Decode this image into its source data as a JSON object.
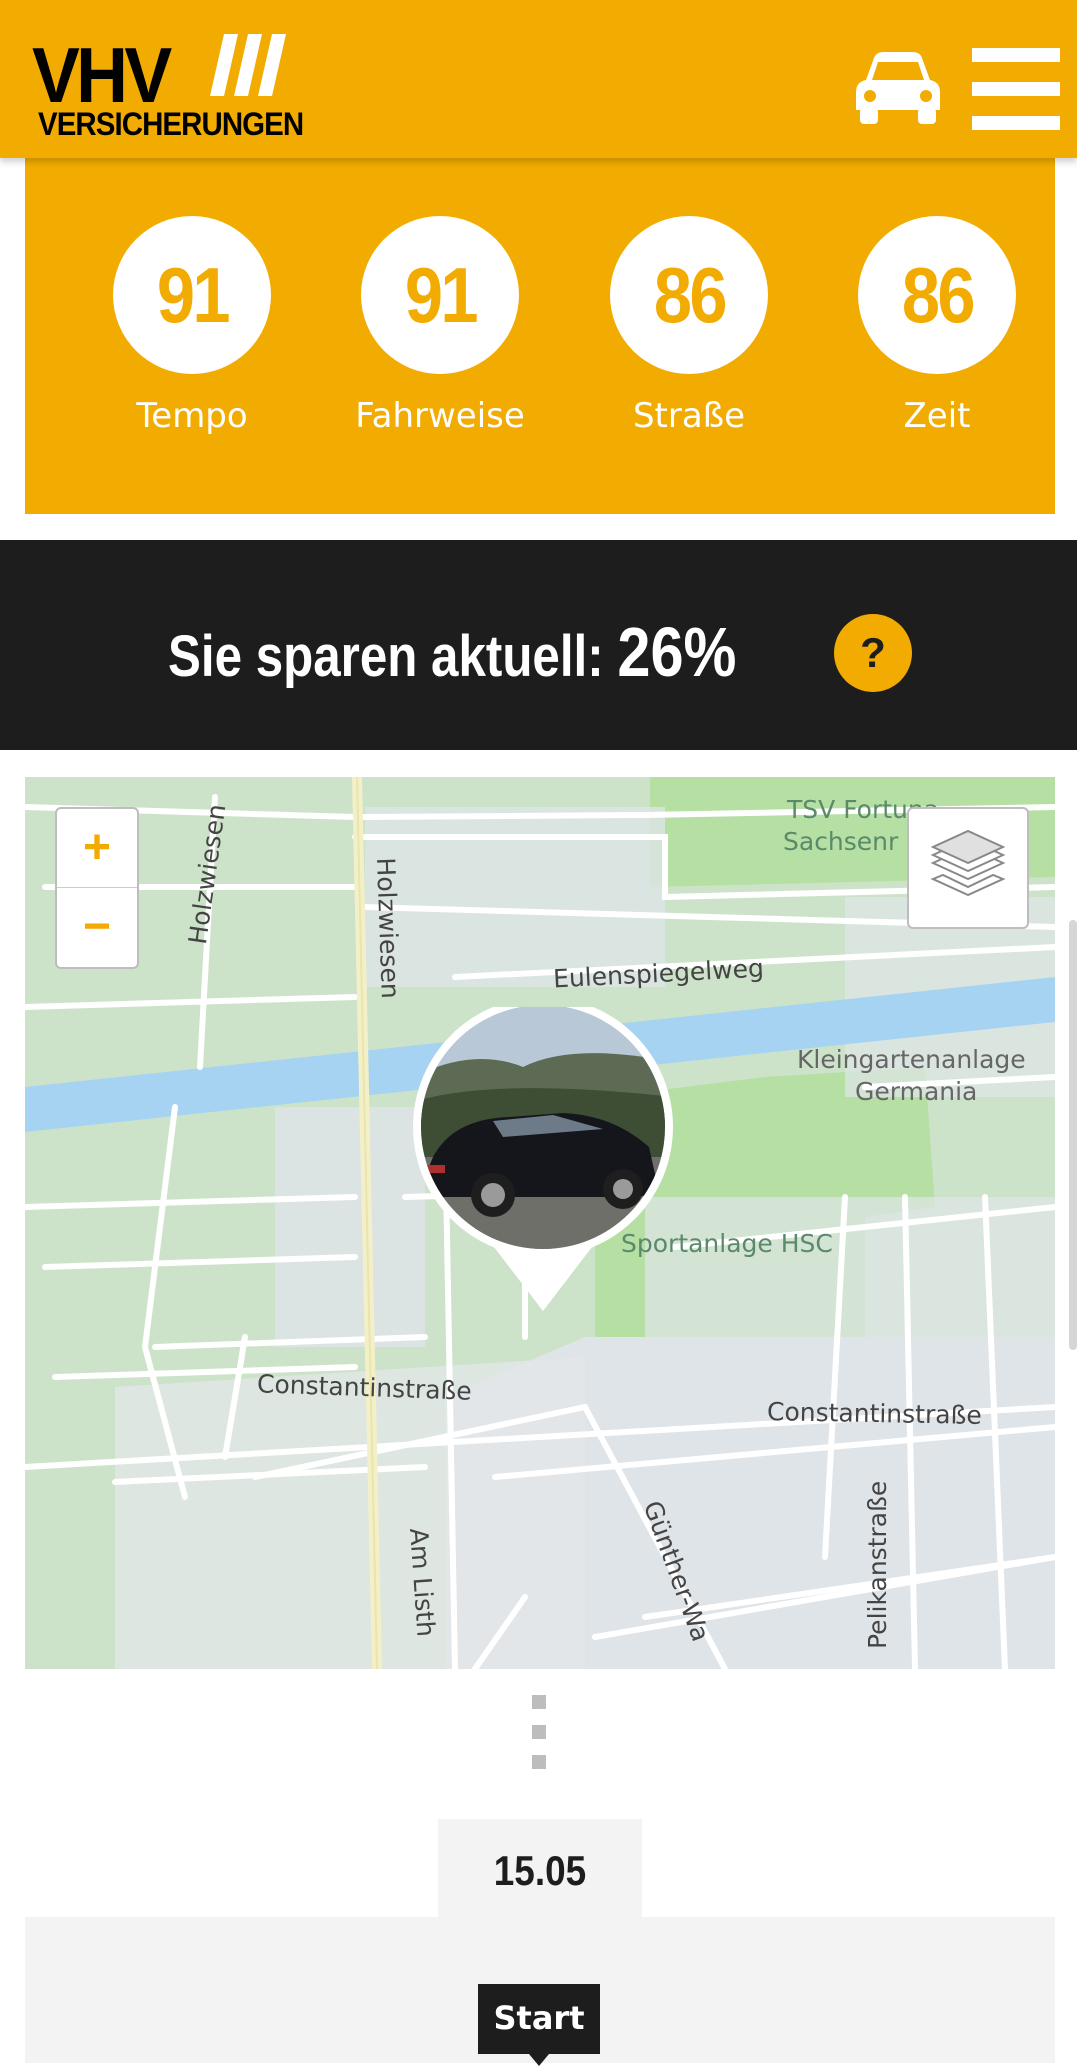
{
  "header": {
    "logo_main": "VHV",
    "logo_sub": "VERSICHERUNGEN",
    "car_icon": "car-icon",
    "menu_icon": "hamburger-menu-icon",
    "brand_color": "#f2ab00"
  },
  "scores": [
    {
      "value": "91",
      "label": "Tempo"
    },
    {
      "value": "91",
      "label": "Fahrweise"
    },
    {
      "value": "86",
      "label": "Straße"
    },
    {
      "value": "86",
      "label": "Zeit"
    }
  ],
  "savings": {
    "text": "Sie sparen aktuell:",
    "percent": "26%",
    "help_label": "?"
  },
  "map": {
    "zoom_in": "+",
    "zoom_out": "−",
    "layers_icon": "layers-icon",
    "labels": {
      "holzwiesen_a": "Holzwiesen",
      "holzwiesen_b": "Holzwiesen",
      "tsv": "TSV Fortuna",
      "tsv2": "Sachsenr",
      "eulenspiegelweg": "Eulenspiegelweg",
      "kleingarten1": "Kleingartenanlage",
      "kleingarten2": "Germania",
      "sportanlage": "Sportanlage HSC",
      "constantin_a": "Constantinstraße",
      "constantin_b": "Constantinstraße",
      "am_listh": "Am Listh",
      "guenther": "Günther-Wa",
      "pelikan": "Pelikanstraße"
    }
  },
  "timeline": {
    "date": "15.05",
    "start_label": "Start"
  }
}
